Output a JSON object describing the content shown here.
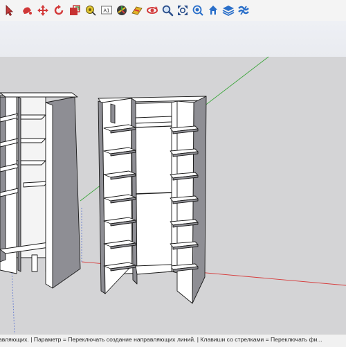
{
  "colors": {
    "ground": "#d4d4d6",
    "panel": "#ffffff",
    "panel_dark": "#8e8e94",
    "edge": "#1a1a1a",
    "axis_red": "#d63b3b",
    "axis_green": "#3aa53a",
    "axis_blue": "#6a7fd0"
  },
  "toolbar": {
    "tools": [
      {
        "name": "select-icon",
        "label": "Select"
      },
      {
        "name": "paint-bucket-icon",
        "label": "Paint Bucket"
      },
      {
        "name": "move-icon",
        "label": "Move"
      },
      {
        "name": "rotate-icon",
        "label": "Rotate"
      },
      {
        "name": "scale-icon",
        "label": "Scale"
      },
      {
        "name": "tape-measure-icon",
        "label": "Tape Measure"
      },
      {
        "name": "text-icon",
        "label": "Text"
      },
      {
        "name": "axes-icon",
        "label": "Axes"
      },
      {
        "name": "section-plane-icon",
        "label": "Section Plane"
      },
      {
        "name": "orbit-icon",
        "label": "Orbit"
      },
      {
        "name": "pan-icon",
        "label": "Pan"
      },
      {
        "name": "zoom-icon",
        "label": "Zoom"
      },
      {
        "name": "zoom-extents-icon",
        "label": "Zoom Extents"
      },
      {
        "name": "warehouse-icon",
        "label": "3D Warehouse"
      },
      {
        "name": "layers-icon",
        "label": "Layers"
      },
      {
        "name": "extension-icon",
        "label": "Extension Warehouse"
      }
    ],
    "text_tool_glyph": "A1"
  },
  "status_bar": {
    "text": "авляющих. | Параметр = Переключать создание направляющих линий. | Клавиши со стрелками = Переключать фи..."
  }
}
